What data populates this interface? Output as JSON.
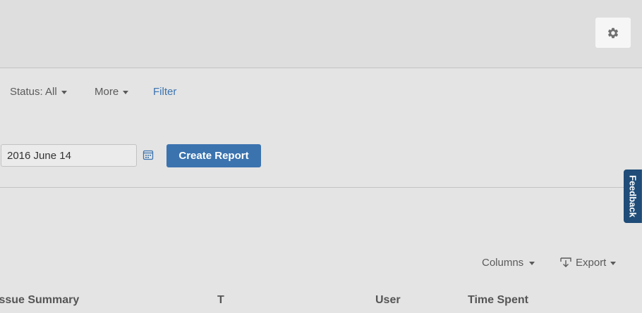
{
  "header": {
    "settings_icon": "gear-icon"
  },
  "filters": {
    "status_label": "Status: All",
    "more_label": "More",
    "filter_link": "Filter"
  },
  "report": {
    "date_value": "2016 June 14",
    "calendar_icon": "calendar-icon",
    "create_button": "Create Report"
  },
  "feedback": {
    "label": "Feedback"
  },
  "table_toolbar": {
    "columns_label": "Columns",
    "export_label": "Export",
    "export_icon": "download-icon"
  },
  "table": {
    "columns": [
      "Issue Summary",
      "T",
      "User",
      "Time Spent"
    ]
  },
  "colors": {
    "accent": "#3b73af",
    "feedback_tab": "#1f4c78",
    "background": "#e4e4e4"
  }
}
